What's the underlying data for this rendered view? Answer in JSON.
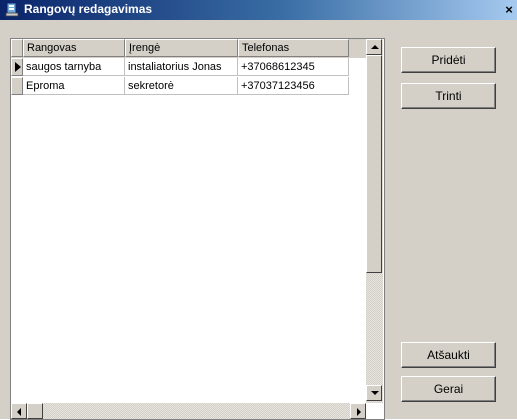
{
  "window": {
    "title": "Rangovų redagavimas",
    "close_label": "×"
  },
  "grid": {
    "columns": [
      "Rangovas",
      "Įrengė",
      "Telefonas"
    ],
    "rows": [
      [
        "saugos tarnyba",
        "instaliatorius Jonas",
        "+37068612345"
      ],
      [
        "Eproma",
        "sekretorė",
        "+37037123456"
      ]
    ],
    "selected_row": 0
  },
  "buttons": {
    "add": "Pridėti",
    "delete": "Trinti",
    "cancel": "Atšaukti",
    "ok": "Gerai"
  },
  "colors": {
    "title_gradient_start": "#0a246a",
    "title_gradient_end": "#a6caf0",
    "face": "#d4d0c8"
  },
  "icons": {
    "title": "app-icon",
    "row_selector": "right-triangle-icon"
  }
}
